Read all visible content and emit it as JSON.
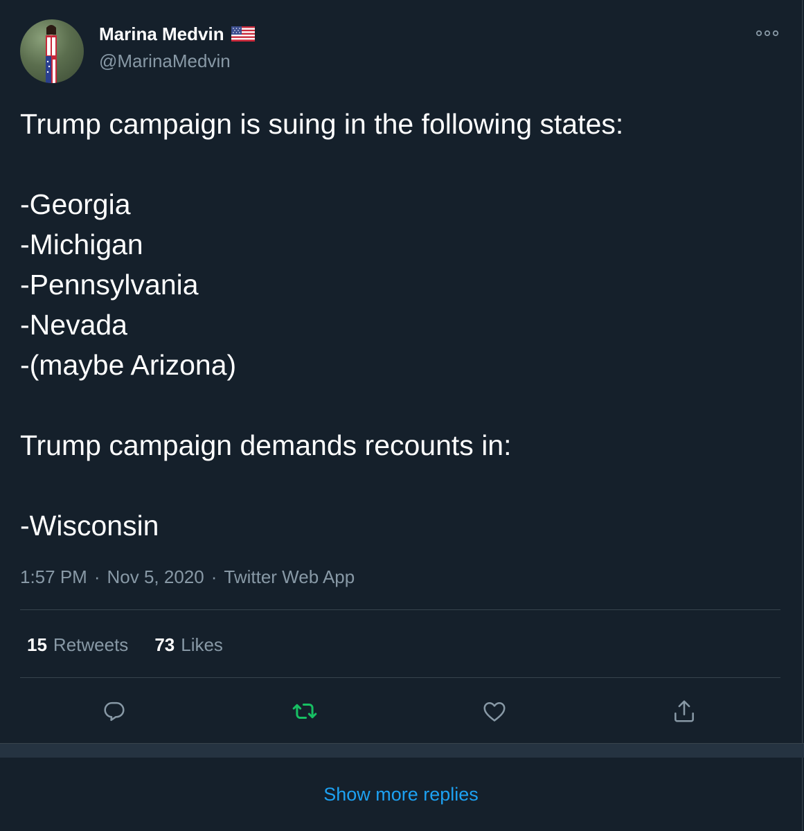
{
  "author": {
    "display_name": "Marina Medvin",
    "handle": "@MarinaMedvin",
    "flag_icon": "us-flag-icon"
  },
  "tweet": {
    "text": "Trump campaign is suing in the following states:\n\n-Georgia\n-Michigan\n-Pennsylvania\n-Nevada\n-(maybe Arizona)\n\nTrump campaign demands recounts in:\n\n-Wisconsin",
    "time": "1:57 PM",
    "date": "Nov 5, 2020",
    "source": "Twitter Web App",
    "separator": "·"
  },
  "stats": {
    "retweets_count": "15",
    "retweets_label": "Retweets",
    "likes_count": "73",
    "likes_label": "Likes"
  },
  "actions": {
    "reply_icon": "reply-icon",
    "retweet_icon": "retweet-icon",
    "like_icon": "heart-icon",
    "share_icon": "share-icon",
    "retweet_color": "#17bf63",
    "icon_color": "#8899a6"
  },
  "footer": {
    "show_more_label": "Show more replies",
    "link_color": "#1da1f2"
  }
}
